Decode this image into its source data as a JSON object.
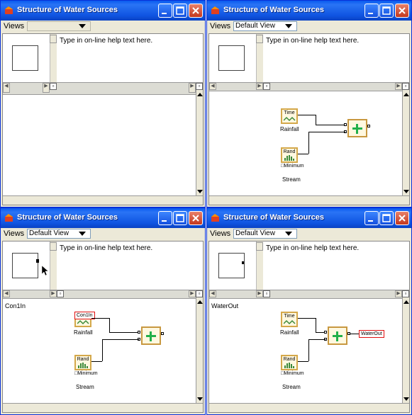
{
  "windows": [
    {
      "title": "Structure of Water Sources",
      "views_label": "Views",
      "views_value": "",
      "help_text": "Type in on-line help text here.",
      "page_label": "",
      "show_diagram": false
    },
    {
      "title": "Structure of Water Sources",
      "views_label": "Views",
      "views_value": "Default View",
      "help_text": "Type in on-line help text here.",
      "page_label": "",
      "show_diagram": true
    },
    {
      "title": "Structure of Water Sources",
      "views_label": "Views",
      "views_value": "Default View",
      "help_text": "Type in on-line help text here.",
      "page_label": "Con1In",
      "show_diagram": true,
      "highlight_in": "Con1In"
    },
    {
      "title": "Structure of Water Sources",
      "views_label": "Views",
      "views_value": "Default View",
      "help_text": "Type in on-line help text here.",
      "page_label": "WaterOut",
      "show_diagram": true,
      "highlight_out": "WaterOut"
    }
  ],
  "diagram": {
    "time_node": "Time",
    "rainfall_label": "Rainfall",
    "rand_node": "Rand",
    "minimum_tag": "Minimum",
    "stream_label": "Stream"
  },
  "colors": {
    "title_bar": "#0a5bef",
    "close_button": "#c4381d",
    "adder_plus": "#22b04a",
    "highlight_border": "#e01010"
  }
}
